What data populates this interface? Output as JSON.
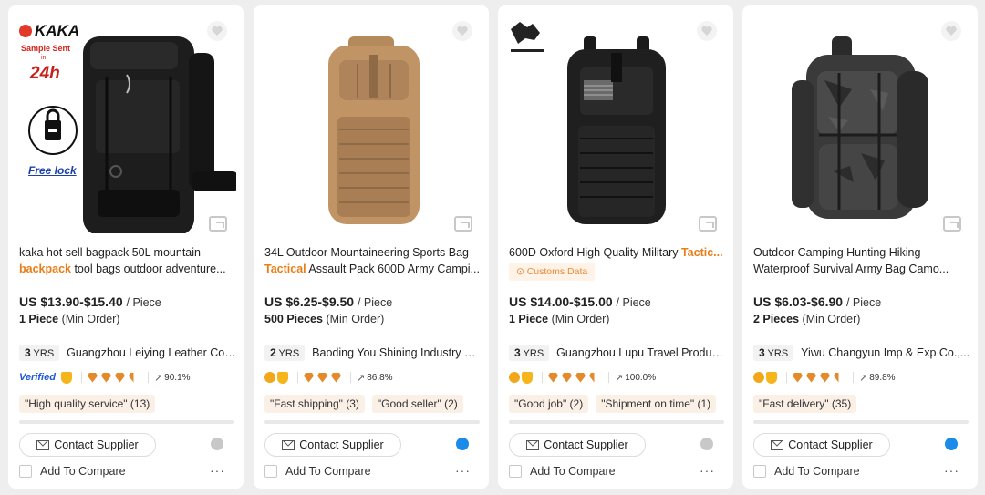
{
  "cards": [
    {
      "title_line1": "kaka hot sell bagpack 50L mountain",
      "keyword": "backpack",
      "title_line2_rest": " tool bags outdoor adventure...",
      "price": "US $13.90-$15.40",
      "unit": "/ Piece",
      "moq_qty": "1 Piece",
      "moq_label": "(Min Order)",
      "yrs_num": "3",
      "yrs_label": "YRS",
      "supplier": "Guangzhou Leiying Leather Co.,...",
      "verified": "Verified",
      "response": "90.1%",
      "tags": [
        "\"High quality service\" (13)"
      ],
      "contact_label": "Contact Supplier",
      "compare_label": "Add To Compare",
      "image_brand": "KAKA",
      "image_text1": "Sample Sent",
      "image_text2": "in",
      "image_text3": "24h",
      "image_text4": "Free lock"
    },
    {
      "title_line1": "34L Outdoor Mountaineering Sports Bag",
      "keyword": "Tactical",
      "title_line2_rest": " Assault Pack 600D Army Campi...",
      "price": "US $6.25-$9.50",
      "unit": "/ Piece",
      "moq_qty": "500 Pieces",
      "moq_label": "(Min Order)",
      "yrs_num": "2",
      "yrs_label": "YRS",
      "supplier": "Baoding You Shining Industry C...",
      "response": "86.8%",
      "tags": [
        "\"Fast shipping\" (3)",
        "\"Good seller\" (2)"
      ],
      "contact_label": "Contact Supplier",
      "compare_label": "Add To Compare"
    },
    {
      "title_line1_pre": "600D Oxford High Quality Military ",
      "keyword": "Tactic...",
      "customs": "Customs Data",
      "price": "US $14.00-$15.00",
      "unit": "/ Piece",
      "moq_qty": "1 Piece",
      "moq_label": "(Min Order)",
      "yrs_num": "3",
      "yrs_label": "YRS",
      "supplier": "Guangzhou Lupu Travel Produc...",
      "response": "100.0%",
      "tags": [
        "\"Good job\" (2)",
        "\"Shipment on time\" (1)"
      ],
      "contact_label": "Contact Supplier",
      "compare_label": "Add To Compare"
    },
    {
      "title_line1": "Outdoor Camping Hunting Hiking",
      "title_line2": "Waterproof Survival Army Bag Camo...",
      "price": "US $6.03-$6.90",
      "unit": "/ Piece",
      "moq_qty": "2 Pieces",
      "moq_label": "(Min Order)",
      "yrs_num": "3",
      "yrs_label": "YRS",
      "supplier": "Yiwu Changyun Imp & Exp Co.,...",
      "response": "89.8%",
      "tags": [
        "\"Fast delivery\" (35)"
      ],
      "contact_label": "Contact Supplier",
      "compare_label": "Add To Compare"
    }
  ],
  "colors": {
    "accent": "#e87e17",
    "verified": "#1c57d2",
    "tag_bg": "#fbf0e6",
    "online": "#1a8be8",
    "offline": "#c8c8c8"
  }
}
